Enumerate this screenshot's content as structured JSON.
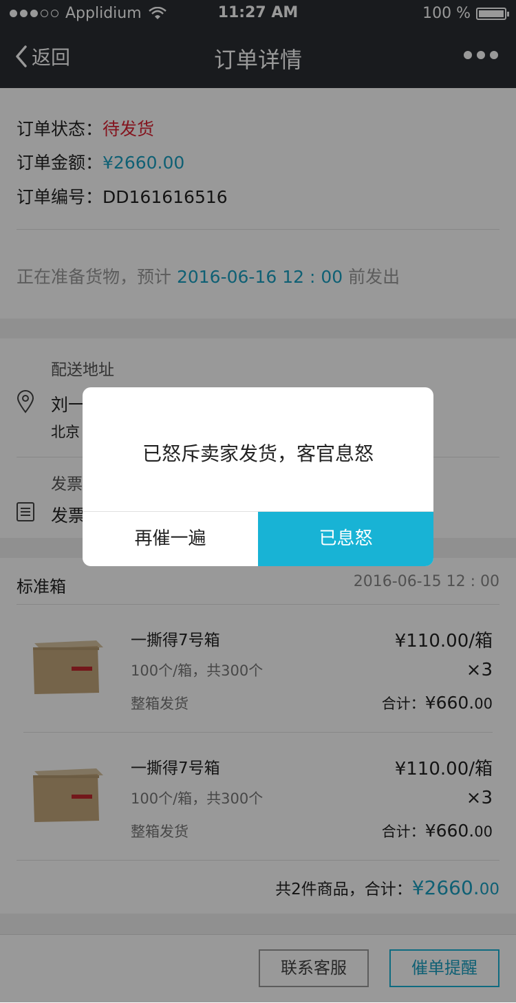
{
  "status_bar": {
    "carrier": "Applidium",
    "time": "11:27 AM",
    "battery": "100 %"
  },
  "nav": {
    "back_label": "返回",
    "title": "订单详情"
  },
  "order": {
    "status_label": "订单状态：",
    "status_value": "待发货",
    "amount_label": "订单金额：",
    "amount_value": "¥2660.00",
    "number_label": "订单编号：",
    "number_value": "DD161616516",
    "prep_prefix": "正在准备货物，预计",
    "prep_date": "2016-06-16",
    "prep_time": "12 : 00",
    "prep_suffix": "前发出"
  },
  "delivery": {
    "label": "配送地址",
    "name_partial": "刘一",
    "address_partial": "北京"
  },
  "invoice": {
    "label": "发票",
    "value_partial": "发票"
  },
  "shipment": {
    "title": "标准箱",
    "datetime": "2016-06-15   12 : 00"
  },
  "items": [
    {
      "name": "一撕得7号箱",
      "spec": "100个/箱，共300个",
      "ship": "整箱发货",
      "unit_price": "¥110.00/箱",
      "qty": "×3",
      "subtotal_label": "合计：",
      "subtotal_int": "¥660.",
      "subtotal_dec": "00"
    },
    {
      "name": "一撕得7号箱",
      "spec": "100个/箱，共300个",
      "ship": "整箱发货",
      "unit_price": "¥110.00/箱",
      "qty": "×3",
      "subtotal_label": "合计：",
      "subtotal_int": "¥660.",
      "subtotal_dec": "00"
    }
  ],
  "summary": {
    "text": "共2件商品，合计：",
    "total_int": "¥2660.",
    "total_dec": "00"
  },
  "footer": {
    "contact": "联系客服",
    "remind": "催单提醒"
  },
  "dialog": {
    "message": "已怒斥卖家发货，客官息怒",
    "cancel": "再催一遍",
    "confirm": "已息怒"
  },
  "colors": {
    "accent": "#18b3d5",
    "status_red": "#d22233",
    "nav_bg": "#2a2e32"
  }
}
